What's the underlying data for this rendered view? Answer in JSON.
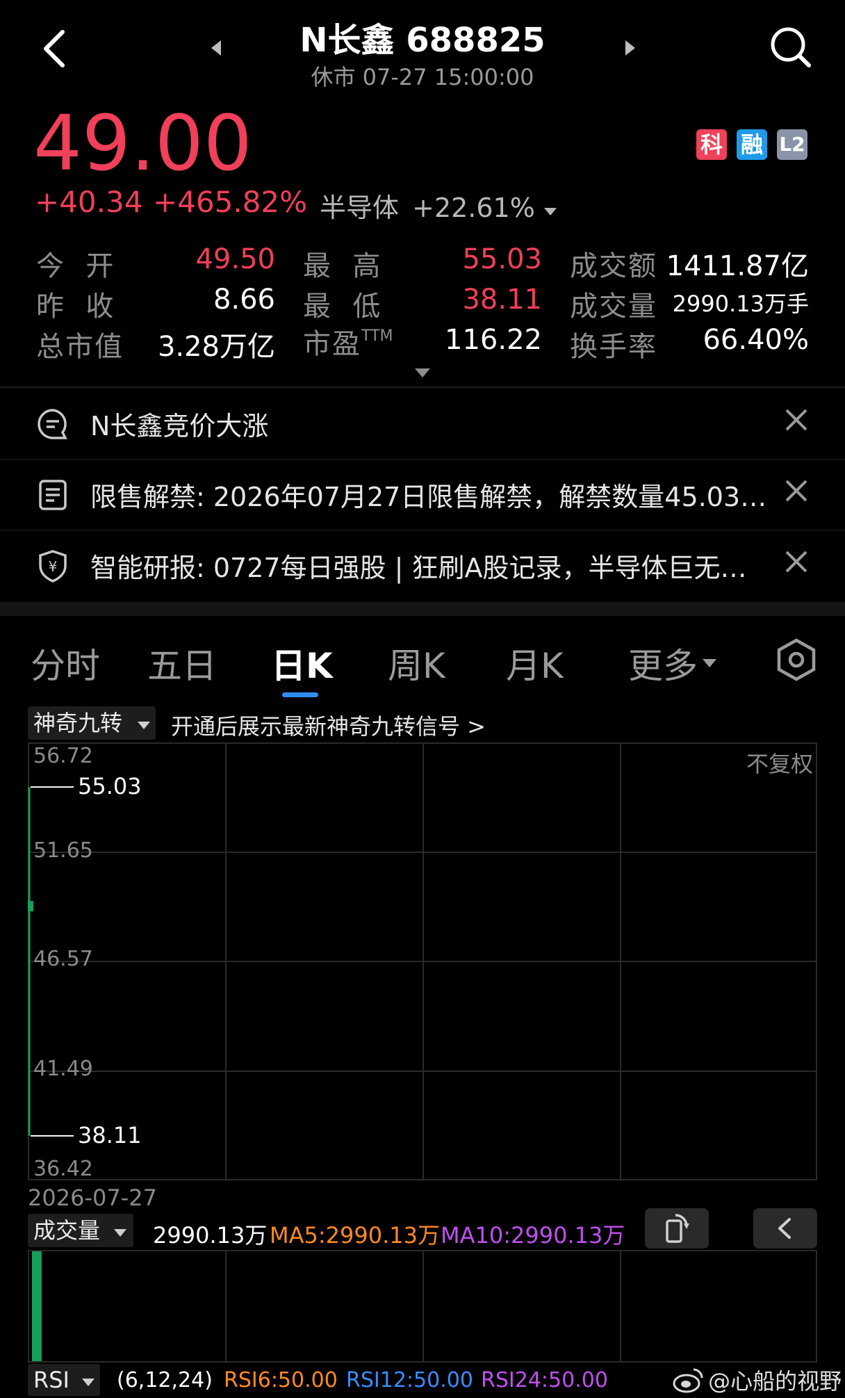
{
  "header": {
    "title": "N长鑫 688825",
    "status": "休市 07-27 15:00:00"
  },
  "quote": {
    "price": "49.00",
    "change": "+40.34",
    "change_pct": "+465.82%",
    "sector_name": "半导体",
    "sector_pct": "+22.61%",
    "badges": [
      "科",
      "融",
      "L2"
    ]
  },
  "stats": {
    "open_label": "今  开",
    "open": "49.50",
    "high_label": "最  高",
    "high": "55.03",
    "amount_label": "成交额",
    "amount": "1411.87亿",
    "prev_label": "昨  收",
    "prev": "8.66",
    "low_label": "最  低",
    "low": "38.11",
    "volume_label": "成交量",
    "volume": "2990.13万手",
    "mcap_label": "总市值",
    "mcap": "3.28万亿",
    "pe_label": "市盈",
    "pe_sup": "TTM",
    "pe": "116.22",
    "turnover_label": "换手率",
    "turnover": "66.40%"
  },
  "notices": [
    {
      "text": "N长鑫竞价大涨"
    },
    {
      "text": "限售解禁: 2026年07月27日限售解禁，解禁数量45.03…"
    },
    {
      "text": "智能研报: 0727每日强股 | 狂刷A股记录，半导体巨无…"
    }
  ],
  "tabs": [
    "分时",
    "五日",
    "日K",
    "周K",
    "月K",
    "更多"
  ],
  "active_tab": "日K",
  "indicator": {
    "dropdown": "神奇九转",
    "promo": "开通后展示最新神奇九转信号 >"
  },
  "chart": {
    "adjust_label": "不复权",
    "y_labels": [
      "56.72",
      "51.65",
      "46.57",
      "41.49",
      "36.42"
    ],
    "high_label": "55.03",
    "low_label": "38.11",
    "date_label": "2026-07-27"
  },
  "chart_data": {
    "type": "candlestick",
    "x": [
      "2026-07-27"
    ],
    "open": [
      49.5
    ],
    "high": [
      55.03
    ],
    "low": [
      38.11
    ],
    "close": [
      49.0
    ],
    "ylim": [
      36.42,
      56.72
    ]
  },
  "volume": {
    "dropdown": "成交量",
    "value": "2990.13万",
    "ma5": "MA5:2990.13万",
    "ma10": "MA10:2990.13万"
  },
  "rsi": {
    "dropdown": "RSI",
    "params": "(6,12,24)",
    "rsi6": "RSI6:50.00",
    "rsi12": "RSI12:50.00",
    "rsi24": "RSI24:50.00"
  },
  "watermark": "@心船的视野",
  "colors": {
    "up": "#f0405a",
    "candle": "#16a05a",
    "ma5": "#ff8a1f",
    "ma10": "#c050f0",
    "rsi12": "#3a8cff",
    "accent": "#2d8cf0"
  }
}
